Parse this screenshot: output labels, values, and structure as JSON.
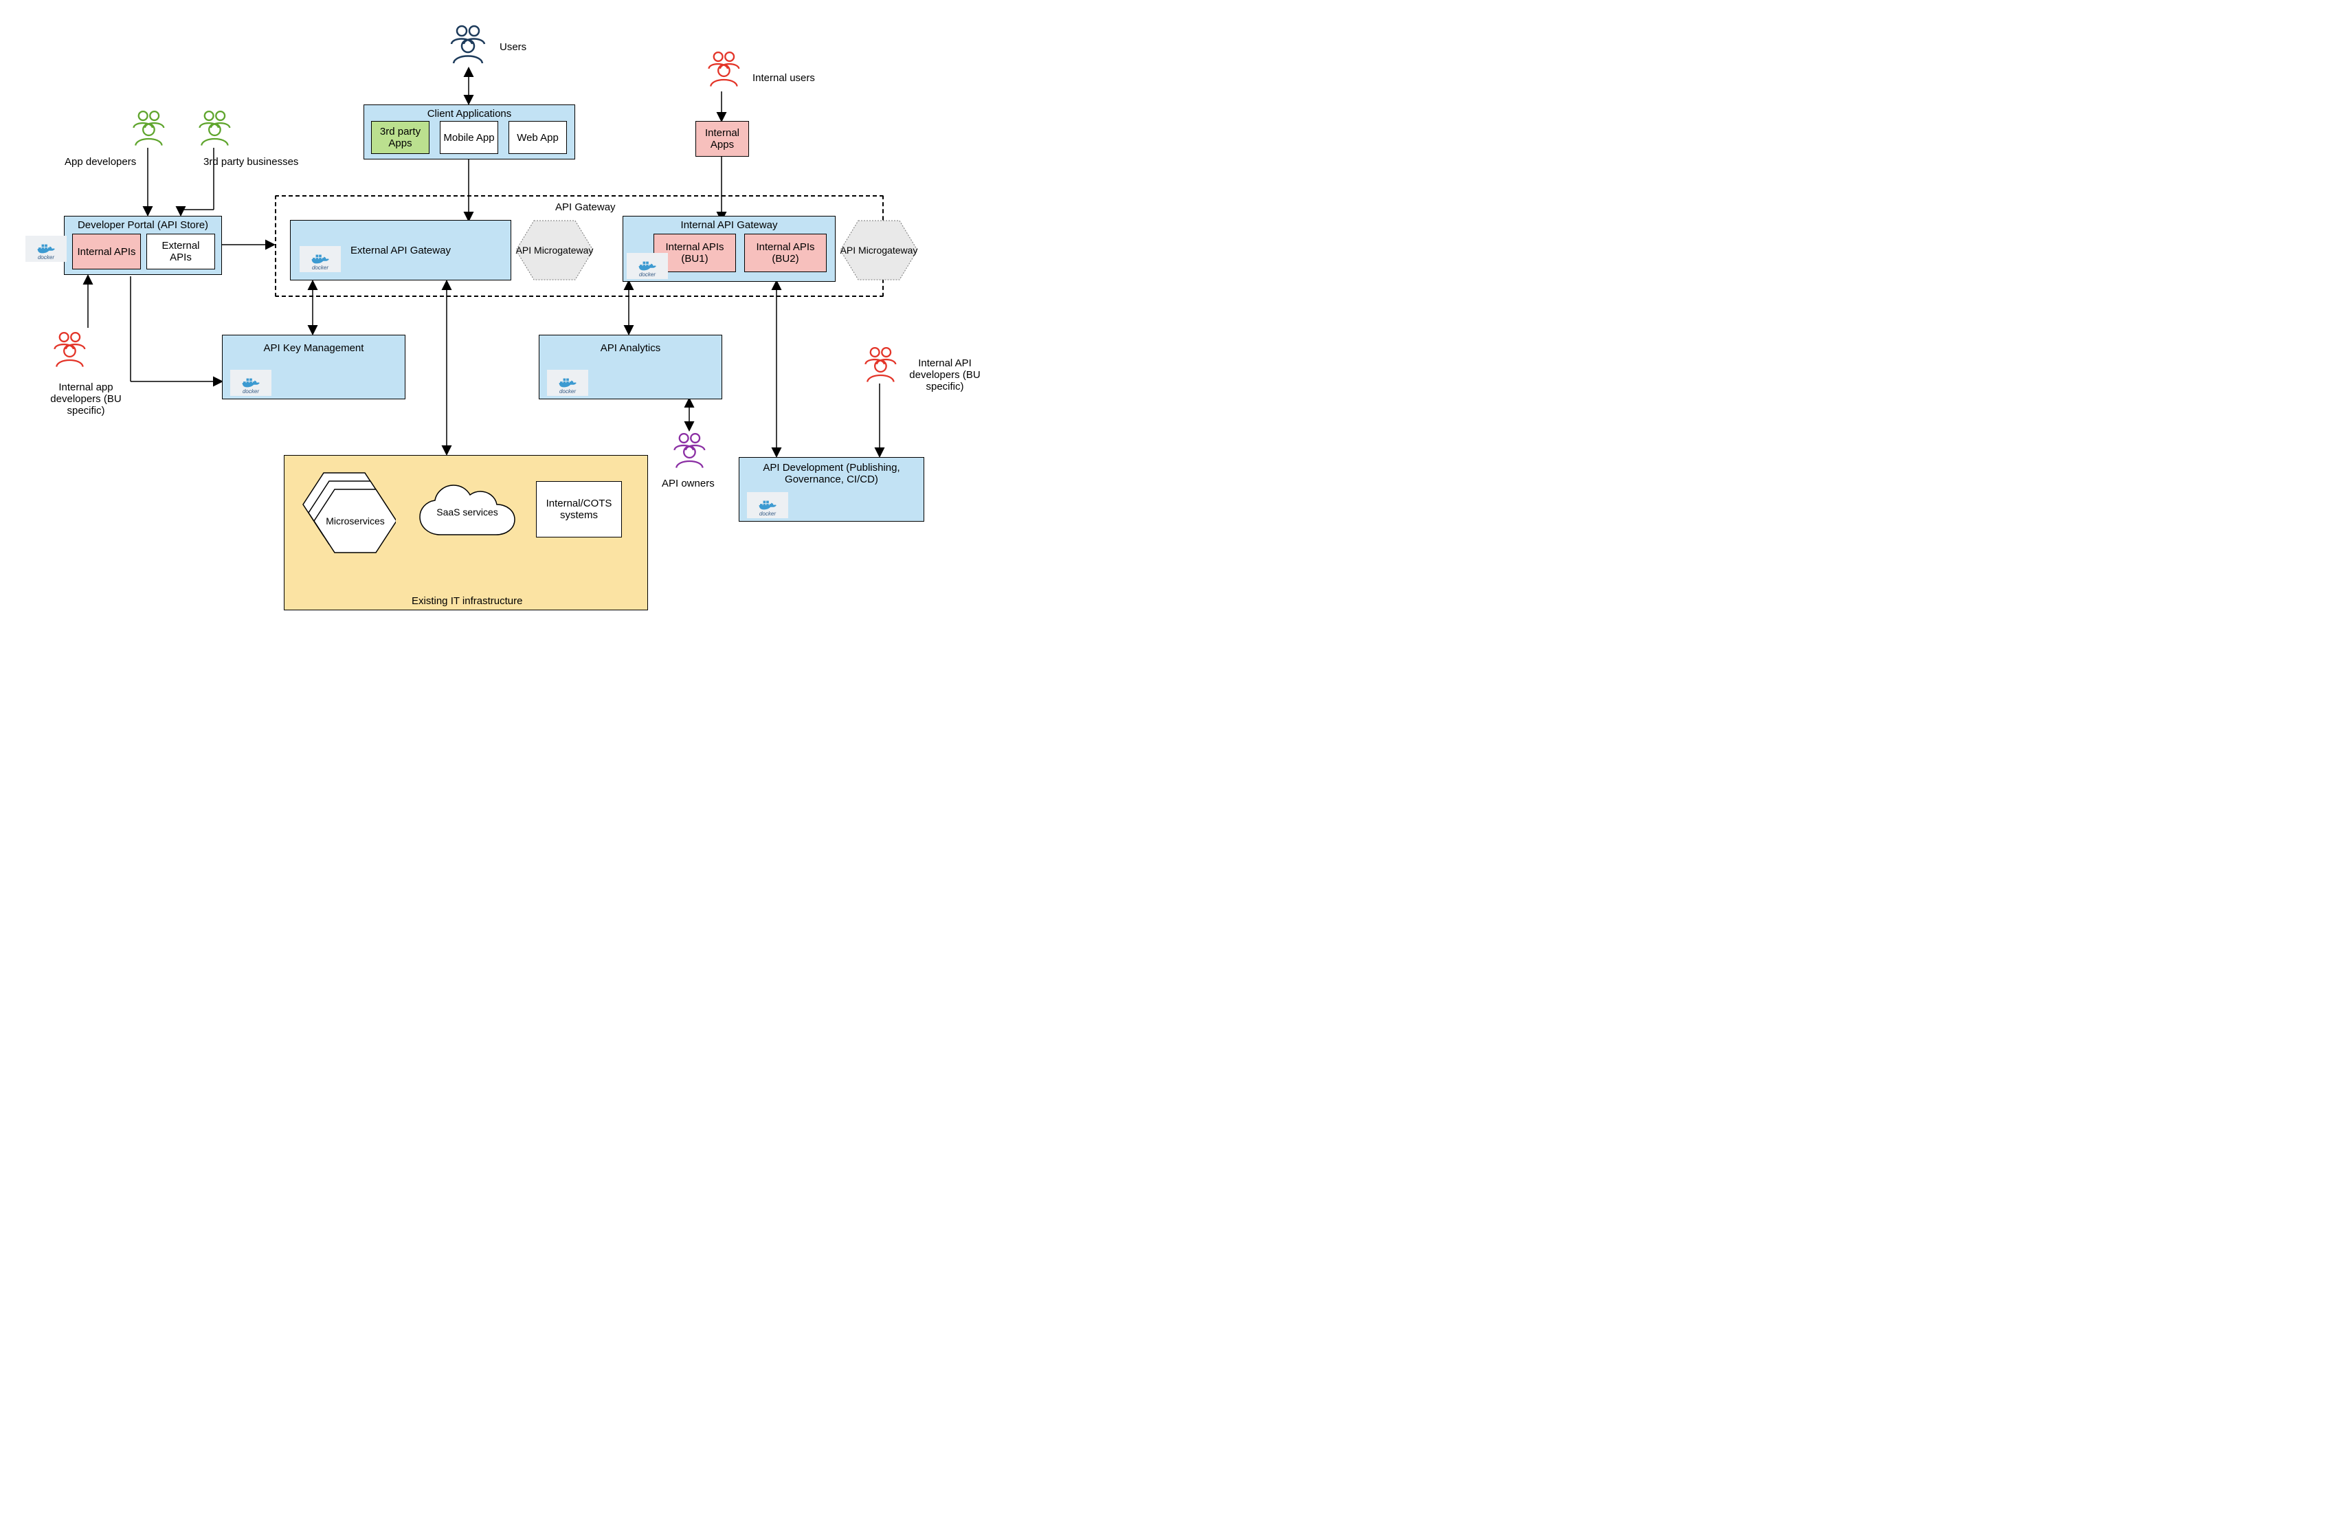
{
  "actors": {
    "users": "Users",
    "internal_users": "Internal users",
    "app_developers": "App developers",
    "third_party_businesses": "3rd party businesses",
    "internal_app_developers": "Internal app developers (BU specific)",
    "internal_api_developers": "Internal API developers (BU specific)",
    "api_owners": "API owners"
  },
  "client_apps": {
    "title": "Client Applications",
    "items": {
      "third_party": "3rd party Apps",
      "mobile": "Mobile App",
      "web": "Web App"
    }
  },
  "internal_apps": "Internal Apps",
  "dev_portal": {
    "title": "Developer Portal (API Store)",
    "internal": "Internal APIs",
    "external": "External APIs"
  },
  "api_gateway": {
    "group_label": "API Gateway",
    "external": "External API Gateway",
    "micro": "API Microgateway",
    "internal_title": "Internal API Gateway",
    "internal_bu1": "Internal APIs (BU1)",
    "internal_bu2": "Internal APIs (BU2)"
  },
  "api_key_mgmt": "API Key Management",
  "api_analytics": "API Analytics",
  "api_dev": "API Development (Publishing, Governance, CI/CD)",
  "infra": {
    "title": "Existing IT infrastructure",
    "microservices": "Microservices",
    "saas": "SaaS services",
    "cots": "Internal/COTS systems"
  },
  "icons": {
    "docker": "docker"
  }
}
